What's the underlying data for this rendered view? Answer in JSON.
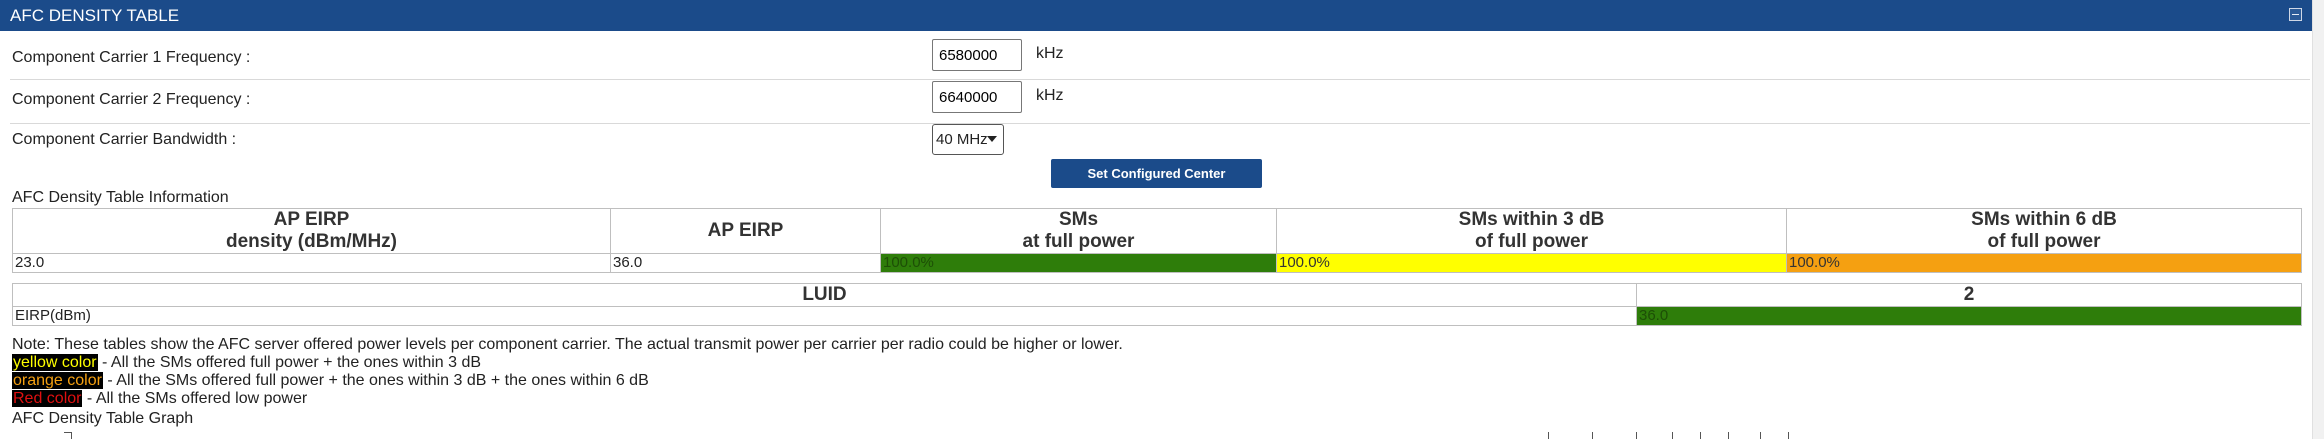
{
  "header": {
    "title": "AFC DENSITY TABLE",
    "collapse_icon": "collapse-icon"
  },
  "form": {
    "cc1": {
      "label": "Component Carrier 1 Frequency :",
      "value": "6580000",
      "unit": "kHz"
    },
    "cc2": {
      "label": "Component Carrier 2 Frequency :",
      "value": "6640000",
      "unit": "kHz"
    },
    "bandwidth": {
      "label": "Component Carrier Bandwidth :",
      "selected": "40 MHz"
    },
    "set_button": "Set Configured Center Frequencies"
  },
  "info_label": "AFC Density Table Information",
  "density_table": {
    "headers": [
      [
        "AP EIRP",
        "density (dBm/MHz)"
      ],
      [
        "AP EIRP"
      ],
      [
        "SMs",
        "at full power"
      ],
      [
        "SMs within 3 dB",
        "of full power"
      ],
      [
        "SMs within 6 dB",
        "of full power"
      ]
    ],
    "row": [
      "23.0",
      "36.0",
      "100.0%",
      "100.0%",
      "100.0%"
    ]
  },
  "luid_table": {
    "headers": [
      "LUID",
      "2"
    ],
    "row": [
      "EIRP(dBm)",
      "36.0"
    ]
  },
  "note": "Note: These tables show the AFC server offered power levels per component carrier. The actual transmit power per carrier per radio could be higher or lower.",
  "legend": [
    {
      "swatch": "yellow color",
      "text": " - All the SMs offered full power + the ones within 3 dB"
    },
    {
      "swatch": "orange color",
      "text": " - All the SMs offered full power + the ones within 3 dB + the ones within 6 dB"
    },
    {
      "swatch": "Red color",
      "text": " - All the SMs offered low power"
    }
  ],
  "graph_label": "AFC Density Table Graph",
  "colors": {
    "header_bg": "#1b4b8a",
    "green": "#2e7d0a",
    "yellow": "#ffff00",
    "orange": "#f5a011",
    "red": "#e01010"
  }
}
